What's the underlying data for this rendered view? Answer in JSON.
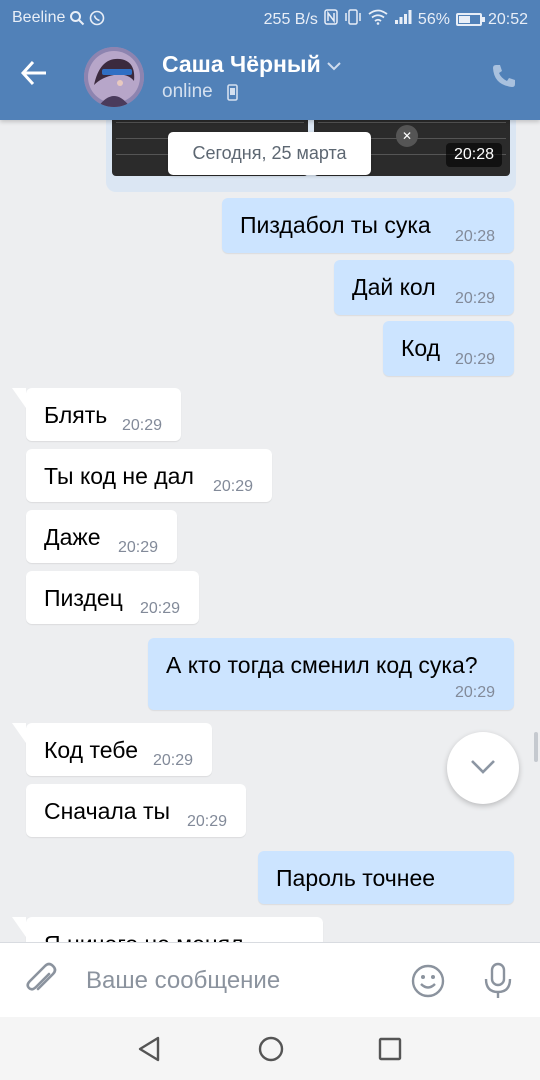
{
  "status_bar": {
    "carrier": "Beeline",
    "net_speed": "255 B/s",
    "battery": "56%",
    "battery_level": 0.56,
    "time": "20:52"
  },
  "header": {
    "contact_name": "Саша Чёрный",
    "status": "online",
    "icons": [
      "back-arrow-icon",
      "chevron-down-icon",
      "mobile-phone-icon",
      "call-icon"
    ],
    "colors": {
      "bar": "#5181b8",
      "outgoing_bubble": "#cce4ff",
      "incoming_bubble": "#ffffff",
      "background": "#edeef0"
    }
  },
  "chat": {
    "date_separator": "Сегодня, 25 марта",
    "media_time": "20:28",
    "messages": [
      {
        "dir": "out",
        "text": "Пиздабол ты сука",
        "time": "20:28"
      },
      {
        "dir": "out",
        "text": "Дай кол",
        "time": "20:29"
      },
      {
        "dir": "out",
        "text": "Код",
        "time": "20:29"
      },
      {
        "dir": "in",
        "text": "Блять",
        "time": "20:29"
      },
      {
        "dir": "in",
        "text": "Ты код не дал",
        "time": "20:29"
      },
      {
        "dir": "in",
        "text": "Даже",
        "time": "20:29"
      },
      {
        "dir": "in",
        "text": "Пиздец",
        "time": "20:29"
      },
      {
        "dir": "out",
        "text": "А кто тогда сменил код сука?",
        "time": "20:29"
      },
      {
        "dir": "in",
        "text": "Код тебе",
        "time": "20:29"
      },
      {
        "dir": "in",
        "text": "Сначала ты",
        "time": "20:29"
      },
      {
        "dir": "out",
        "text": "Пароль точнее",
        "time": ""
      },
      {
        "dir": "in",
        "text": "Я ничего не менял",
        "time": ""
      }
    ]
  },
  "composer": {
    "placeholder": "Ваше сообщение",
    "value": ""
  }
}
